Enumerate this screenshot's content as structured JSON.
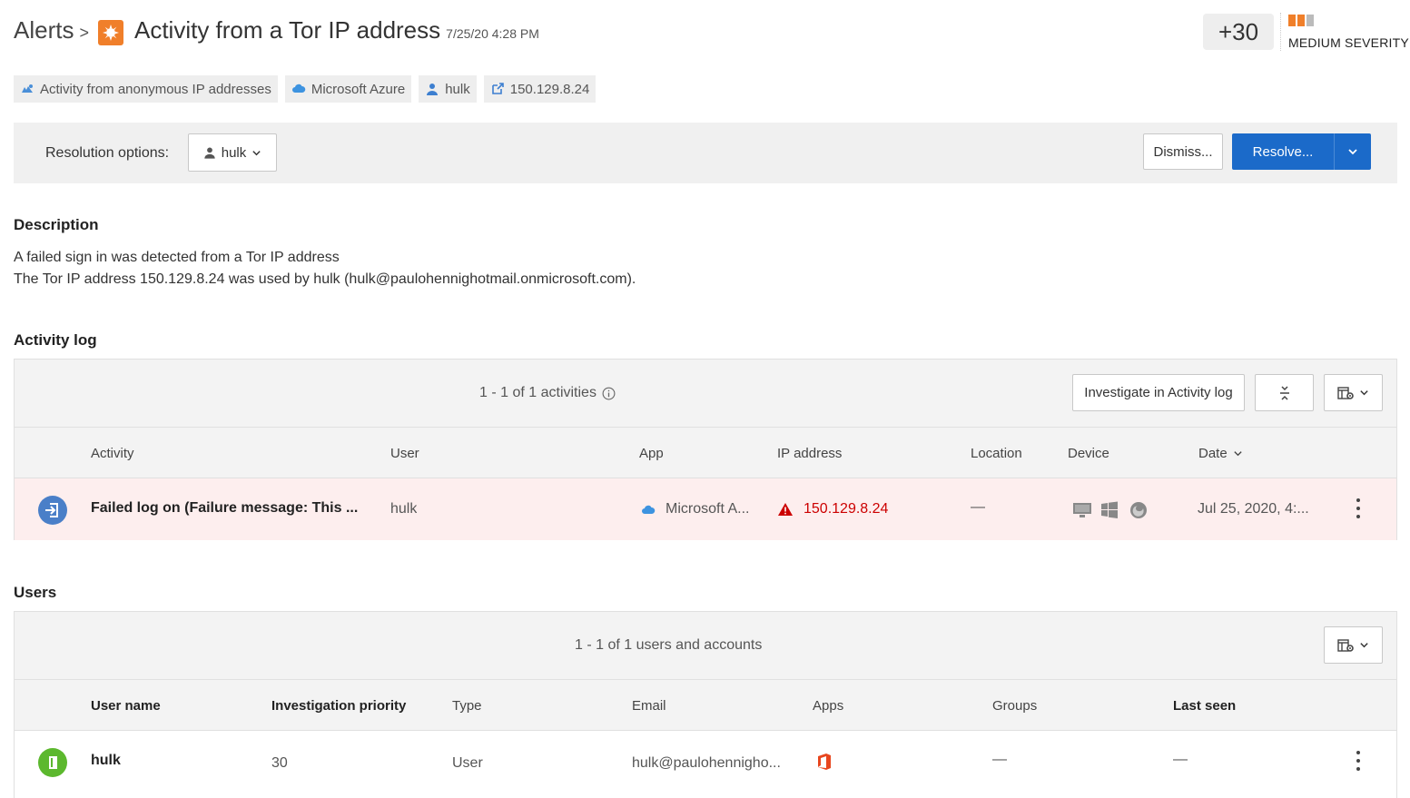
{
  "header": {
    "breadcrumb_root": "Alerts",
    "breadcrumb_sep": ">",
    "title": "Activity from a Tor IP address",
    "timestamp": "7/25/20 4:28 PM",
    "score": "+30",
    "severity_label": "MEDIUM SEVERITY",
    "severity_level": 2,
    "severity_max": 3,
    "severity_color": "#f07f2a"
  },
  "tags": [
    {
      "label": "Activity from anonymous IP addresses",
      "icon": "anonymous-ip-icon"
    },
    {
      "label": "Microsoft Azure",
      "icon": "azure-cloud-icon"
    },
    {
      "label": "hulk",
      "icon": "user-icon"
    },
    {
      "label": "150.129.8.24",
      "icon": "external-link-icon"
    }
  ],
  "resolution": {
    "label": "Resolution options:",
    "user_button": "hulk",
    "dismiss": "Dismiss...",
    "resolve": "Resolve..."
  },
  "description": {
    "title": "Description",
    "line1": "A failed sign in was detected from a Tor IP address",
    "line2": "The Tor IP address 150.129.8.24 was used by hulk (hulk@paulohennighotmail.onmicrosoft.com)."
  },
  "activity_log": {
    "title": "Activity log",
    "count": "1 - 1 of 1 activities",
    "investigate_button": "Investigate in Activity log",
    "columns": [
      "Activity",
      "User",
      "App",
      "IP address",
      "Location",
      "Device",
      "Date"
    ],
    "rows": [
      {
        "activity": "Failed log on (Failure message: This ...",
        "user": "hulk",
        "app": "Microsoft A...",
        "ip": "150.129.8.24",
        "location": "—",
        "date": "Jul 25, 2020, 4:..."
      }
    ]
  },
  "users": {
    "title": "Users",
    "count": "1 - 1 of 1 users and accounts",
    "columns": [
      "User name",
      "Investigation priority",
      "Type",
      "Email",
      "Apps",
      "Groups",
      "Last seen"
    ],
    "rows": [
      {
        "name": "hulk",
        "priority": "30",
        "type": "User",
        "email": "hulk@paulohennigho...",
        "groups": "—",
        "last_seen": "—"
      }
    ]
  },
  "colors": {
    "accent_blue": "#1b6ac9",
    "alert_red": "#cc0000",
    "severity_orange": "#f07f2a",
    "user_green": "#5cb82e"
  }
}
